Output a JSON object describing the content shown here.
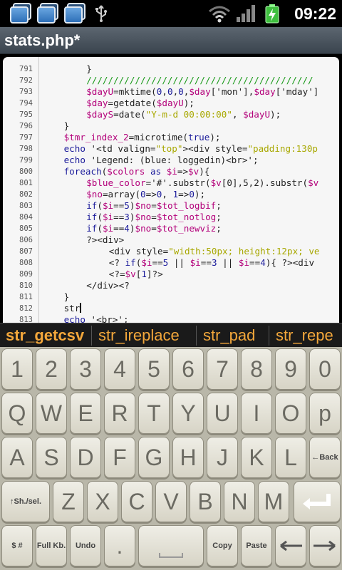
{
  "status_bar": {
    "time": "09:22"
  },
  "title_bar": {
    "title": "stats.php*"
  },
  "editor": {
    "lines": [
      {
        "n": "791",
        "indent": 8,
        "tokens": [
          {
            "t": "}",
            "c": ""
          }
        ]
      },
      {
        "n": "792",
        "indent": 8,
        "tokens": [
          {
            "t": "//////////////////////////////////////////",
            "c": "c"
          }
        ]
      },
      {
        "n": "793",
        "indent": 8,
        "tokens": [
          {
            "t": "$dayU",
            "c": "v"
          },
          {
            "t": "=mktime(",
            "c": ""
          },
          {
            "t": "0",
            "c": "n"
          },
          {
            "t": ",",
            "c": ""
          },
          {
            "t": "0",
            "c": "n"
          },
          {
            "t": ",",
            "c": ""
          },
          {
            "t": "0",
            "c": "n"
          },
          {
            "t": ",",
            "c": ""
          },
          {
            "t": "$day",
            "c": "v"
          },
          {
            "t": "['mon'],",
            "c": ""
          },
          {
            "t": "$day",
            "c": "v"
          },
          {
            "t": "['mday']",
            "c": ""
          }
        ]
      },
      {
        "n": "794",
        "indent": 8,
        "tokens": [
          {
            "t": "$day",
            "c": "v"
          },
          {
            "t": "=getdate(",
            "c": ""
          },
          {
            "t": "$dayU",
            "c": "v"
          },
          {
            "t": ");",
            "c": ""
          }
        ]
      },
      {
        "n": "795",
        "indent": 8,
        "tokens": [
          {
            "t": "$dayS",
            "c": "v"
          },
          {
            "t": "=date(",
            "c": ""
          },
          {
            "t": "\"Y-m-d 00:00:00\"",
            "c": "s"
          },
          {
            "t": ", ",
            "c": ""
          },
          {
            "t": "$dayU",
            "c": "v"
          },
          {
            "t": ");",
            "c": ""
          }
        ]
      },
      {
        "n": "796",
        "indent": 4,
        "tokens": [
          {
            "t": "}",
            "c": ""
          }
        ]
      },
      {
        "n": "797",
        "indent": 4,
        "tokens": [
          {
            "t": "$tmr_index_2",
            "c": "v"
          },
          {
            "t": "=microtime(",
            "c": ""
          },
          {
            "t": "true",
            "c": "k"
          },
          {
            "t": ");",
            "c": ""
          }
        ]
      },
      {
        "n": "798",
        "indent": 4,
        "tokens": [
          {
            "t": "echo",
            "c": "k"
          },
          {
            "t": " '<td valign=",
            "c": ""
          },
          {
            "t": "\"top\"",
            "c": "s"
          },
          {
            "t": "><div style=",
            "c": ""
          },
          {
            "t": "\"padding:130p",
            "c": "s"
          }
        ]
      },
      {
        "n": "799",
        "indent": 4,
        "tokens": [
          {
            "t": "echo",
            "c": "k"
          },
          {
            "t": " 'Legend: (blue: loggedin)<br>';",
            "c": ""
          }
        ]
      },
      {
        "n": "800",
        "indent": 4,
        "tokens": [
          {
            "t": "foreach",
            "c": "k"
          },
          {
            "t": "(",
            "c": ""
          },
          {
            "t": "$colors",
            "c": "v"
          },
          {
            "t": " ",
            "c": ""
          },
          {
            "t": "as",
            "c": "k"
          },
          {
            "t": " ",
            "c": ""
          },
          {
            "t": "$i",
            "c": "v"
          },
          {
            "t": "=>",
            "c": ""
          },
          {
            "t": "$v",
            "c": "v"
          },
          {
            "t": "){",
            "c": ""
          }
        ]
      },
      {
        "n": "801",
        "indent": 8,
        "tokens": [
          {
            "t": "$blue_color",
            "c": "v"
          },
          {
            "t": "='#'.substr(",
            "c": ""
          },
          {
            "t": "$v",
            "c": "v"
          },
          {
            "t": "[0],5,2).substr(",
            "c": ""
          },
          {
            "t": "$v",
            "c": "v"
          }
        ]
      },
      {
        "n": "802",
        "indent": 8,
        "tokens": [
          {
            "t": "$no",
            "c": "v"
          },
          {
            "t": "=array(",
            "c": ""
          },
          {
            "t": "0",
            "c": "n"
          },
          {
            "t": "=>",
            "c": ""
          },
          {
            "t": "0",
            "c": "n"
          },
          {
            "t": ", ",
            "c": ""
          },
          {
            "t": "1",
            "c": "n"
          },
          {
            "t": "=>",
            "c": ""
          },
          {
            "t": "0",
            "c": "n"
          },
          {
            "t": ");",
            "c": ""
          }
        ]
      },
      {
        "n": "803",
        "indent": 8,
        "tokens": [
          {
            "t": "if",
            "c": "k"
          },
          {
            "t": "(",
            "c": ""
          },
          {
            "t": "$i",
            "c": "v"
          },
          {
            "t": "==",
            "c": ""
          },
          {
            "t": "5",
            "c": "n"
          },
          {
            "t": ")",
            "c": ""
          },
          {
            "t": "$no",
            "c": "v"
          },
          {
            "t": "=",
            "c": ""
          },
          {
            "t": "$tot_logbif",
            "c": "v"
          },
          {
            "t": ";",
            "c": ""
          }
        ]
      },
      {
        "n": "804",
        "indent": 8,
        "tokens": [
          {
            "t": "if",
            "c": "k"
          },
          {
            "t": "(",
            "c": ""
          },
          {
            "t": "$i",
            "c": "v"
          },
          {
            "t": "==",
            "c": ""
          },
          {
            "t": "3",
            "c": "n"
          },
          {
            "t": ")",
            "c": ""
          },
          {
            "t": "$no",
            "c": "v"
          },
          {
            "t": "=",
            "c": ""
          },
          {
            "t": "$tot_notlog",
            "c": "v"
          },
          {
            "t": ";",
            "c": ""
          }
        ]
      },
      {
        "n": "805",
        "indent": 8,
        "tokens": [
          {
            "t": "if",
            "c": "k"
          },
          {
            "t": "(",
            "c": ""
          },
          {
            "t": "$i",
            "c": "v"
          },
          {
            "t": "==",
            "c": ""
          },
          {
            "t": "4",
            "c": "n"
          },
          {
            "t": ")",
            "c": ""
          },
          {
            "t": "$no",
            "c": "v"
          },
          {
            "t": "=",
            "c": ""
          },
          {
            "t": "$tot_newviz",
            "c": "v"
          },
          {
            "t": ";",
            "c": ""
          }
        ]
      },
      {
        "n": "806",
        "indent": 8,
        "tokens": [
          {
            "t": "?><div>",
            "c": ""
          }
        ]
      },
      {
        "n": "807",
        "indent": 12,
        "tokens": [
          {
            "t": "<div style=",
            "c": ""
          },
          {
            "t": "\"width:50px; height:12px; ve",
            "c": "s"
          }
        ]
      },
      {
        "n": "808",
        "indent": 12,
        "tokens": [
          {
            "t": "<? ",
            "c": ""
          },
          {
            "t": "if",
            "c": "k"
          },
          {
            "t": "(",
            "c": ""
          },
          {
            "t": "$i",
            "c": "v"
          },
          {
            "t": "==",
            "c": ""
          },
          {
            "t": "5",
            "c": "n"
          },
          {
            "t": " || ",
            "c": ""
          },
          {
            "t": "$i",
            "c": "v"
          },
          {
            "t": "==",
            "c": ""
          },
          {
            "t": "3",
            "c": "n"
          },
          {
            "t": " || ",
            "c": ""
          },
          {
            "t": "$i",
            "c": "v"
          },
          {
            "t": "==",
            "c": ""
          },
          {
            "t": "4",
            "c": "n"
          },
          {
            "t": "){ ?><div",
            "c": ""
          }
        ]
      },
      {
        "n": "809",
        "indent": 12,
        "tokens": [
          {
            "t": "<?=",
            "c": ""
          },
          {
            "t": "$v",
            "c": "v"
          },
          {
            "t": "[",
            "c": ""
          },
          {
            "t": "1",
            "c": "n"
          },
          {
            "t": "]?>",
            "c": ""
          }
        ]
      },
      {
        "n": "810",
        "indent": 8,
        "tokens": [
          {
            "t": "</div><?",
            "c": ""
          }
        ]
      },
      {
        "n": "811",
        "indent": 4,
        "tokens": [
          {
            "t": "}",
            "c": ""
          }
        ]
      },
      {
        "n": "812",
        "indent": 4,
        "tokens": [
          {
            "t": "str",
            "c": ""
          }
        ],
        "cursor": true
      },
      {
        "n": "813",
        "indent": 4,
        "tokens": [
          {
            "t": "echo",
            "c": "k"
          },
          {
            "t": " '<br>';",
            "c": ""
          }
        ]
      }
    ]
  },
  "suggestions": [
    "str_getcsv",
    "str_ireplace",
    "str_pad",
    "str_repe"
  ],
  "keyboard": {
    "row_numbers": [
      "1",
      "2",
      "3",
      "4",
      "5",
      "6",
      "7",
      "8",
      "9",
      "0"
    ],
    "row_q": [
      "Q",
      "W",
      "E",
      "R",
      "T",
      "Y",
      "U",
      "I",
      "O",
      "p"
    ],
    "row_a": [
      "A",
      "S",
      "D",
      "F",
      "G",
      "H",
      "J",
      "K",
      "L"
    ],
    "back_label": "←Back",
    "shift_label": "↑Sh./sel.",
    "row_z": [
      "Z",
      "X",
      "C",
      "V",
      "B",
      "N",
      "M"
    ],
    "enter_icon": "enter-arrow-icon",
    "bottom": {
      "symbols_label": "$ #",
      "full_kb_label": "Full Kb.",
      "undo_label": "Undo",
      "dot_label": ".",
      "copy_label": "Copy",
      "paste_label": "Paste",
      "left_icon": "arrow-left-icon",
      "right_icon": "arrow-right-icon",
      "space_icon": "space-bar-icon"
    }
  }
}
